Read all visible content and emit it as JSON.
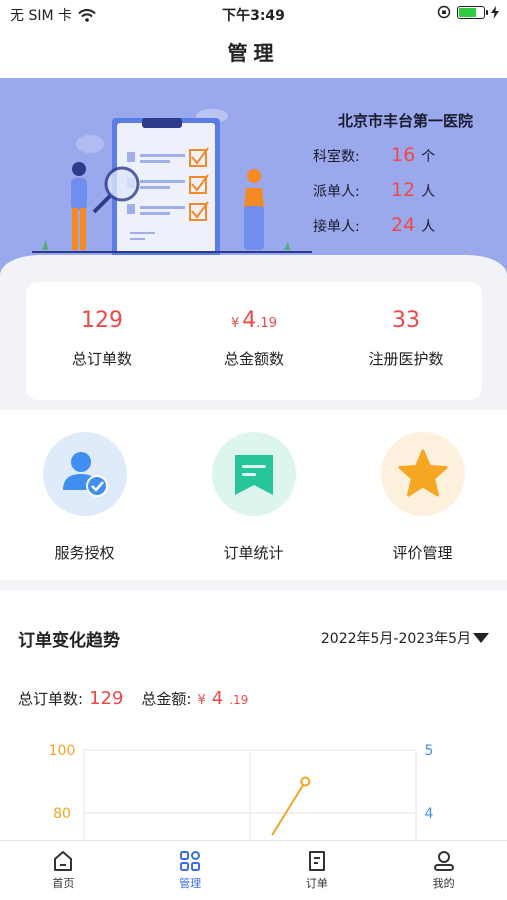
{
  "status_bar": {
    "carrier": "无 SIM 卡",
    "time": "下午3:49",
    "battery_level": 0.75
  },
  "nav": {
    "title": "管理"
  },
  "hospital": {
    "name": "北京市丰台第一医院",
    "departments_label": "科室数:",
    "departments_value": "16",
    "departments_unit": "个",
    "dispatchers_label": "派单人:",
    "dispatchers_value": "12",
    "dispatchers_unit": "人",
    "receivers_label": "接单人:",
    "receivers_value": "24",
    "receivers_unit": "人"
  },
  "stats": {
    "orders_value": "129",
    "orders_label": "总订单数",
    "amount_currency": "¥",
    "amount_int": "4",
    "amount_dec": ".19",
    "amount_label": "总金额数",
    "caregivers_value": "33",
    "caregivers_label": "注册医护数"
  },
  "menu": {
    "items": [
      {
        "label": "服务授权",
        "icon": "user-check-icon",
        "bg": "#dfeafb",
        "color": "#3f8ef0"
      },
      {
        "label": "订单统计",
        "icon": "message-list-icon",
        "bg": "#dcf6ee",
        "color": "#27c59a"
      },
      {
        "label": "评价管理",
        "icon": "star-icon",
        "bg": "#fdf0dd",
        "color": "#f5a623"
      }
    ]
  },
  "trend": {
    "title": "订单变化趋势",
    "date_range": "2022年5月-2023年5月",
    "orders_label": "总订单数:",
    "orders_value": "129",
    "amount_label": "总金额:",
    "amount_currency": "¥",
    "amount_int": "4",
    "amount_dec": ".19"
  },
  "chart_data": {
    "type": "line",
    "y_left_ticks": [
      "100",
      "80"
    ],
    "y_right_ticks": [
      "5",
      "4"
    ],
    "left_axis_color": "#f5a623",
    "right_axis_color": "#4a90e2",
    "series": [
      {
        "axis": "left",
        "color": "#f5a623",
        "points": [
          [
            1.7,
            73
          ],
          [
            2.0,
            90
          ]
        ]
      }
    ],
    "ylim_left": [
      60,
      100
    ],
    "x_range": [
      0,
      3
    ],
    "grid": true
  },
  "tabs": [
    {
      "label": "首页",
      "icon": "home-icon",
      "active": false
    },
    {
      "label": "管理",
      "icon": "grid-icon",
      "active": true
    },
    {
      "label": "订单",
      "icon": "document-icon",
      "active": false
    },
    {
      "label": "我的",
      "icon": "profile-icon",
      "active": false
    }
  ],
  "colors": {
    "accent": "#3a6fe8",
    "highlight": "#f04848",
    "hero_bg": "#9aa9ec"
  }
}
